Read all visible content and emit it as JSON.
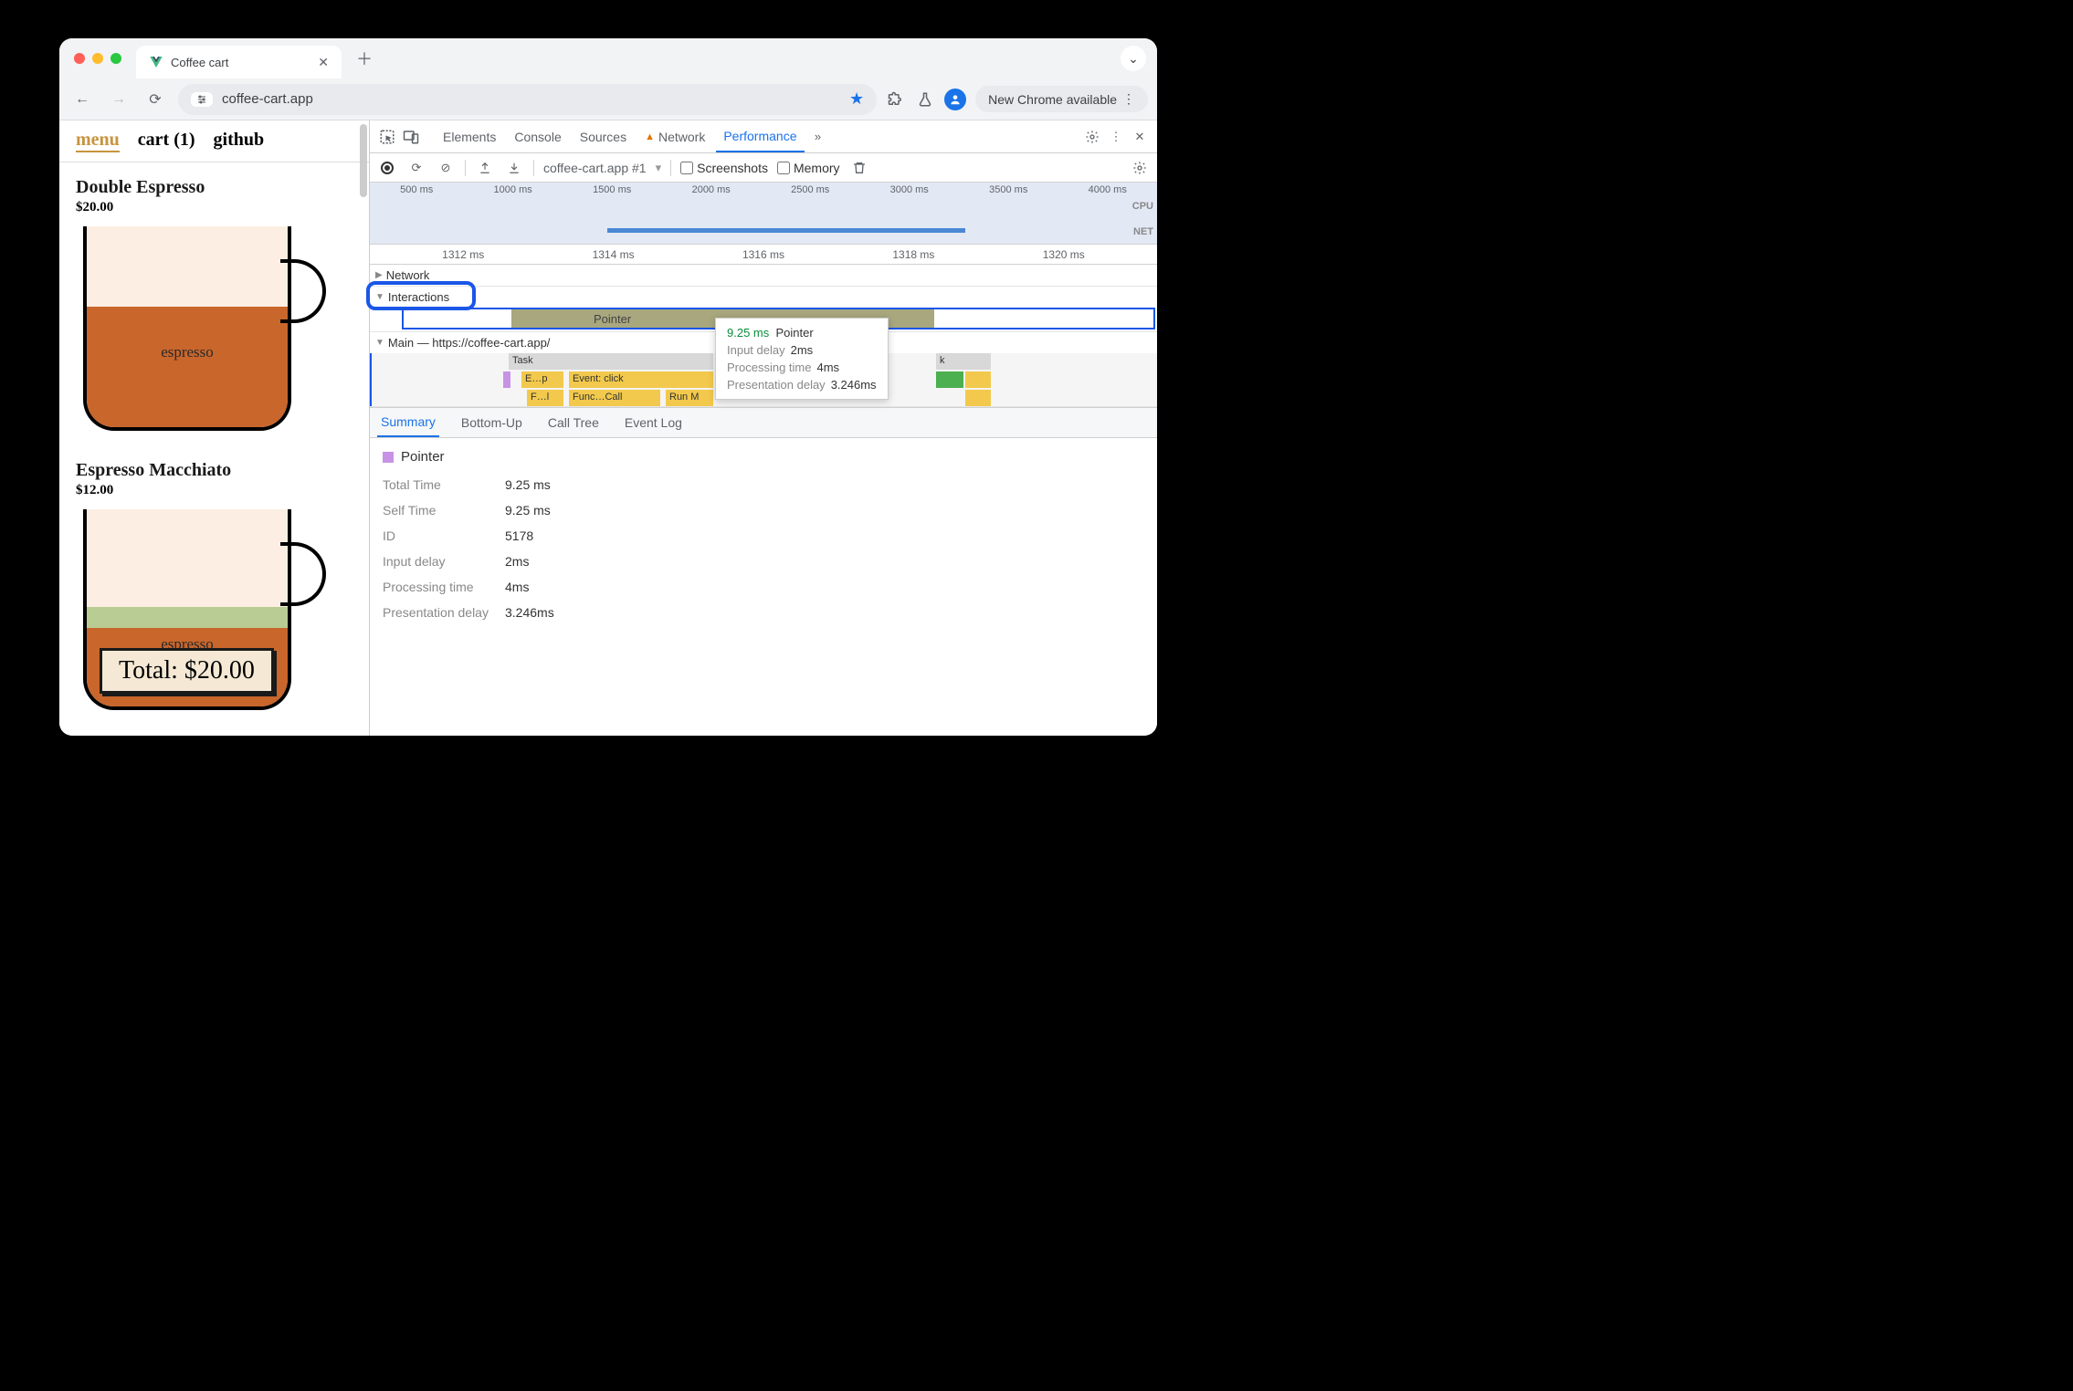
{
  "browser": {
    "tab_title": "Coffee cart",
    "url": "coffee-cart.app",
    "update_label": "New Chrome available"
  },
  "page": {
    "nav": {
      "menu": "menu",
      "cart": "cart (1)",
      "github": "github"
    },
    "products": [
      {
        "name": "Double Espresso",
        "price": "$20.00",
        "fill_label": "espresso"
      },
      {
        "name": "Espresso Macchiato",
        "price": "$12.00",
        "fill_label": "espresso"
      }
    ],
    "total_label": "Total: $20.00"
  },
  "devtools": {
    "tabs": {
      "elements": "Elements",
      "console": "Console",
      "sources": "Sources",
      "network": "Network",
      "performance": "Performance"
    },
    "perf": {
      "url_target": "coffee-cart.app #1",
      "screenshots": "Screenshots",
      "memory": "Memory",
      "overview_ticks": [
        "500 ms",
        "1000 ms",
        "1500 ms",
        "2000 ms",
        "2500 ms",
        "3000 ms",
        "3500 ms",
        "4000 ms"
      ],
      "overview_labels": {
        "cpu": "CPU",
        "net": "NET"
      },
      "ruler_ticks": [
        "1312 ms",
        "1314 ms",
        "1316 ms",
        "1318 ms",
        "1320 ms"
      ],
      "tracks": {
        "network": "Network",
        "interactions": "Interactions",
        "interaction_item": "Pointer",
        "main": "Main — https://coffee-cart.app/",
        "flame": {
          "task": "Task",
          "ep": "E…p",
          "event_click": "Event: click",
          "fl": "F…l",
          "func_call": "Func…Call",
          "run": "Run M"
        }
      },
      "tooltip": {
        "heading_time": "9.25 ms",
        "heading_name": "Pointer",
        "rows": [
          {
            "k": "Input delay",
            "v": "2ms"
          },
          {
            "k": "Processing time",
            "v": "4ms"
          },
          {
            "k": "Presentation delay",
            "v": "3.246ms"
          }
        ]
      },
      "detail_tabs": {
        "summary": "Summary",
        "bottom_up": "Bottom-Up",
        "call_tree": "Call Tree",
        "event_log": "Event Log"
      },
      "summary": {
        "title": "Pointer",
        "rows": [
          {
            "k": "Total Time",
            "v": "9.25 ms"
          },
          {
            "k": "Self Time",
            "v": "9.25 ms"
          },
          {
            "k": "ID",
            "v": "5178"
          },
          {
            "k": "Input delay",
            "v": "2ms"
          },
          {
            "k": "Processing time",
            "v": "4ms"
          },
          {
            "k": "Presentation delay",
            "v": "3.246ms"
          }
        ]
      }
    }
  }
}
